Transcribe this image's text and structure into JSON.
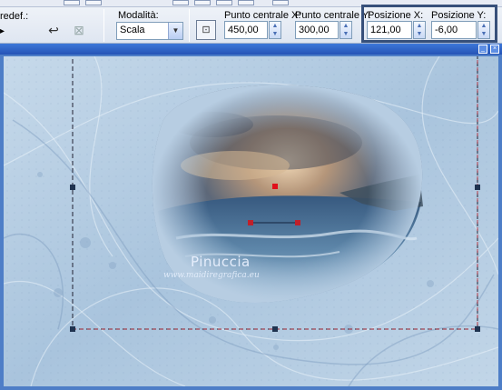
{
  "toolbar": {
    "preset_label": "redef.:",
    "mode_label": "Modalità:",
    "mode_value": "Scala",
    "center_x_label": "Punto centrale X:",
    "center_x_value": "450,00",
    "center_y_label": "Punto centrale Y:",
    "center_y_value": "300,00",
    "pos_x_label": "Posizione X:",
    "pos_x_value": "121,00",
    "pos_y_label": "Posizione Y:",
    "pos_y_value": "-6,00",
    "highlight_color": "#37507a"
  },
  "canvas": {
    "watermark_name": "Pinuccia",
    "watermark_url": "www.maidiregrafica.eu",
    "handle_color": "#1f3350",
    "center_handle_color": "#e0101a"
  }
}
